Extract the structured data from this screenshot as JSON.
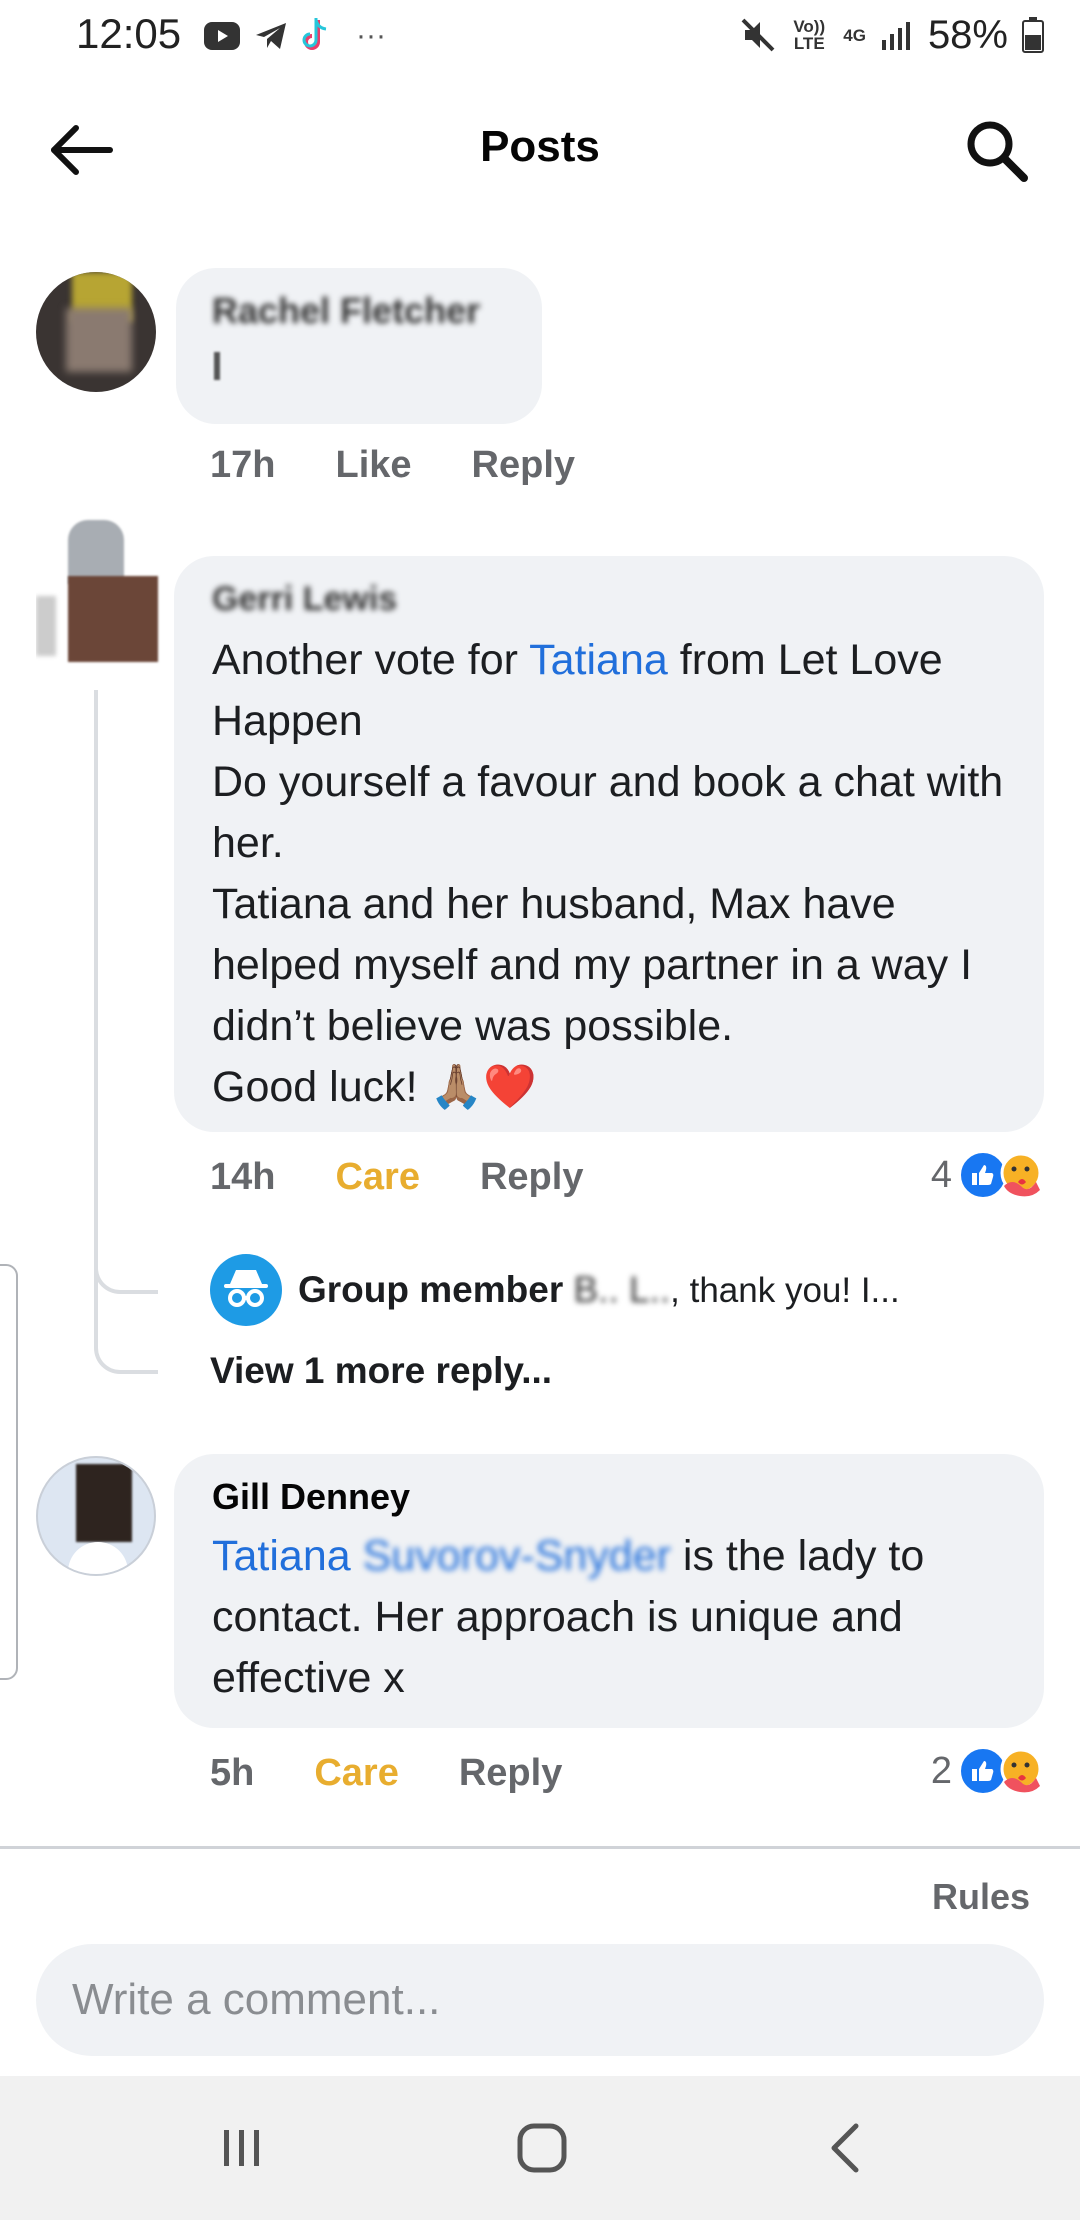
{
  "status_bar": {
    "time": "12:05",
    "more": "···",
    "network": "Vo)) LTE",
    "data_type": "4G",
    "battery": "58%"
  },
  "header": {
    "title": "Posts"
  },
  "comments": [
    {
      "author": "Rachel Fletcher",
      "text": "",
      "time": "17h",
      "action_1": "Like",
      "reply": "Reply"
    },
    {
      "author": "Gerri Lewis",
      "text_before": "Another vote for ",
      "mention": "Tatiana",
      "text_after": " from Let Love Happen\nDo yourself a favour and book a chat with her.\nTatiana and her husband, Max have helped myself and my partner in a way I didn’t believe was possible.\nGood luck! 🙏🏽❤️",
      "time": "14h",
      "action_1": "Care",
      "reply": "Reply",
      "reaction_count": "4",
      "replies": {
        "author_label": "Group member",
        "author_blurred": "B.. L..",
        "preview": ", thank you! I...",
        "view_more": "View 1 more reply..."
      }
    },
    {
      "author": "Gill Denney",
      "mention": "Tatiana",
      "mention_blurred": "Suvorov-Snyder",
      "text_after": " is the lady to contact. Her approach is unique and effective x",
      "time": "5h",
      "action_1": "Care",
      "reply": "Reply",
      "reaction_count": "2"
    }
  ],
  "footer": {
    "rules": "Rules",
    "comment_placeholder": "Write a comment..."
  },
  "colors": {
    "bubble": "#f0f2f5",
    "mention": "#216fdb",
    "care": "#e8ad2f",
    "like_blue": "#1877f2",
    "meta_grey": "#65676b"
  }
}
